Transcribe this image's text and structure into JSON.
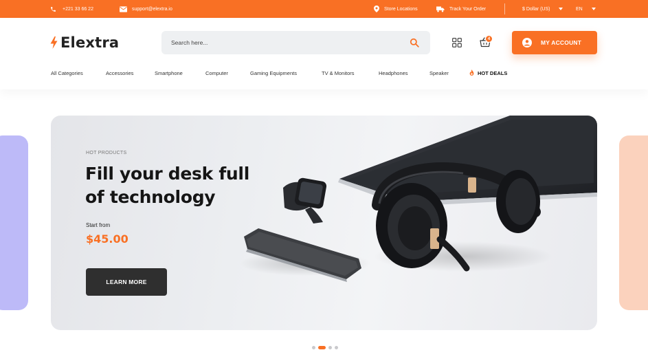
{
  "topbar": {
    "phone": "+221 33 66 22",
    "email": "support@elextra.io",
    "store_locations": "Store Locations",
    "track_order": "Track Your Order",
    "currency": "$ Dollar (US)",
    "language": "EN"
  },
  "header": {
    "logo_text": "Elextra",
    "search_placeholder": "Search here...",
    "cart_count": "4",
    "account_label": "MY ACCOUNT"
  },
  "nav": {
    "items": [
      "All Categories",
      "Accessories",
      "Smartphone",
      "Computer",
      "Gaming Equipments",
      "TV & Monitors",
      "Headphones",
      "Speaker"
    ],
    "hot_deals": "HOT DEALS"
  },
  "hero": {
    "eyebrow": "HOT PRODUCTS",
    "headline_line1": "Fill your desk full",
    "headline_line2": "of technology",
    "start_label": "Start from",
    "price": "$45.00",
    "cta": "LEARN MORE"
  },
  "slider": {
    "slide_count": 4,
    "active_slide": 2
  },
  "colors": {
    "accent": "#f97024",
    "dark_button": "#2f2f2f",
    "side_left": "#bdbaf8",
    "side_right": "#fbd2bd"
  },
  "icons": [
    "phone-icon",
    "mail-icon",
    "location-pin-icon",
    "truck-icon",
    "chevron-down-icon",
    "bolt-logo-icon",
    "search-icon",
    "grid-icon",
    "basket-icon",
    "user-icon",
    "fire-icon"
  ]
}
